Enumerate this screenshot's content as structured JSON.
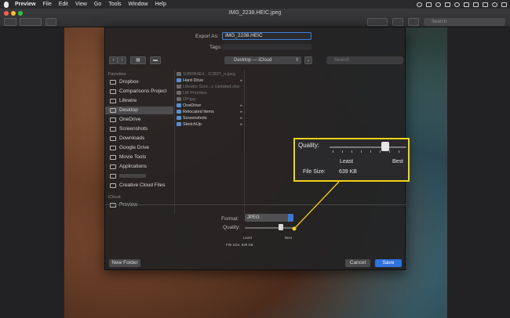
{
  "menubar": {
    "app_name": "Preview",
    "menus": [
      "File",
      "Edit",
      "View",
      "Go",
      "Tools",
      "Window",
      "Help"
    ]
  },
  "window": {
    "title": "IMG_2238.HEIC.jpeg",
    "search_placeholder": "Search"
  },
  "sheet": {
    "export_as_label": "Export As:",
    "export_as_value": "IMG_2238.HEIC",
    "tags_label": "Tags:",
    "location": "Desktop — iCloud",
    "search_placeholder": "Search",
    "sidebar": {
      "favorites_header": "Favorites",
      "favorites": [
        "Dropbox",
        "Comparisons Project",
        "Lifewire",
        "Desktop",
        "OneDrive",
        "Screenshots",
        "Downloads",
        "Google Drive",
        "Movie Tools",
        "Applications",
        "",
        "Creative Cloud Files"
      ],
      "selected": "Desktop",
      "icloud_header": "iCloud",
      "icloud": [
        "Preview"
      ]
    },
    "files": [
      {
        "name": "1DB6B4E4...1CB0T_n.jpeg",
        "dim": true,
        "arrow": ""
      },
      {
        "name": "Hard Drive",
        "dim": false,
        "arrow": "▸"
      },
      {
        "name": "Lifewire Scre...s Updated.xlsx",
        "dim": true,
        "arrow": ""
      },
      {
        "name": "LW Priorities",
        "dim": true,
        "arrow": ""
      },
      {
        "name": "OP.jpg",
        "dim": true,
        "arrow": ""
      },
      {
        "name": "OneDrive",
        "dim": false,
        "arrow": "▸"
      },
      {
        "name": "Relocated Items",
        "dim": false,
        "arrow": "▸"
      },
      {
        "name": "Screenshots",
        "dim": false,
        "arrow": "▸"
      },
      {
        "name": "SketchUp",
        "dim": false,
        "arrow": "▸"
      }
    ],
    "format_label": "Format:",
    "format_value": "JPEG",
    "quality_label": "Quality:",
    "least_label": "Least",
    "best_label": "Best",
    "file_size_label": "File Size:",
    "file_size_value": "639 KB",
    "new_folder_label": "New Folder",
    "cancel_label": "Cancel",
    "save_label": "Save"
  },
  "callout": {
    "quality_label": "Quality:",
    "least_label": "Least",
    "best_label": "Best",
    "file_size_label": "File Size:",
    "file_size_value": "639 KB",
    "quality_level": 0.75
  },
  "colors": {
    "accent": "#2f72e0",
    "callout_border": "#f2d21a"
  }
}
